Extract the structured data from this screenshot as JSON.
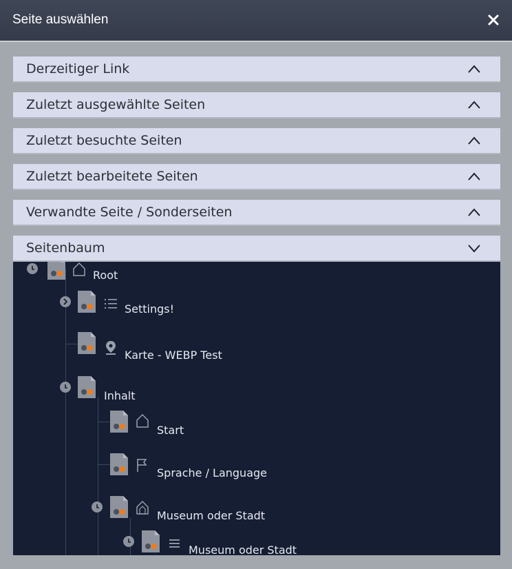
{
  "dialog": {
    "title": "Seite auswählen",
    "close_icon": "close-icon"
  },
  "panels": [
    {
      "label": "Derzeitiger Link",
      "state": "collapsed"
    },
    {
      "label": "Zuletzt ausgewählte Seiten",
      "state": "collapsed"
    },
    {
      "label": "Zuletzt besuchte Seiten",
      "state": "collapsed"
    },
    {
      "label": "Zuletzt bearbeitete Seiten",
      "state": "collapsed"
    },
    {
      "label": "Verwandte Seite / Sonderseiten",
      "state": "collapsed"
    },
    {
      "label": "Seitenbaum",
      "state": "expanded"
    }
  ],
  "tree": {
    "nodes": [
      {
        "label": "Root",
        "level": 0,
        "expander": "expanded",
        "icon": "home-icon"
      },
      {
        "label": "Settings!",
        "level": 1,
        "expander": "collapsed",
        "icon": "list-icon"
      },
      {
        "label": "Karte - WEBP Test",
        "level": 1,
        "expander": "none",
        "icon": "map-pin-icon"
      },
      {
        "label": "Inhalt",
        "level": 1,
        "expander": "expanded",
        "icon": "none"
      },
      {
        "label": "Start",
        "level": 2,
        "expander": "none",
        "icon": "home-icon"
      },
      {
        "label": "Sprache / Language",
        "level": 2,
        "expander": "none",
        "icon": "flag-icon"
      },
      {
        "label": "Museum oder Stadt",
        "level": 2,
        "expander": "expanded",
        "icon": "home-icon"
      },
      {
        "label": "Museum oder Stadt",
        "level": 3,
        "expander": "expanded",
        "icon": "menu-icon"
      }
    ]
  },
  "colors": {
    "titlebar": "#3c4353",
    "panel_header": "#d9dcec",
    "tree_background": "#151e33",
    "page_accent": "#f07d1a"
  }
}
